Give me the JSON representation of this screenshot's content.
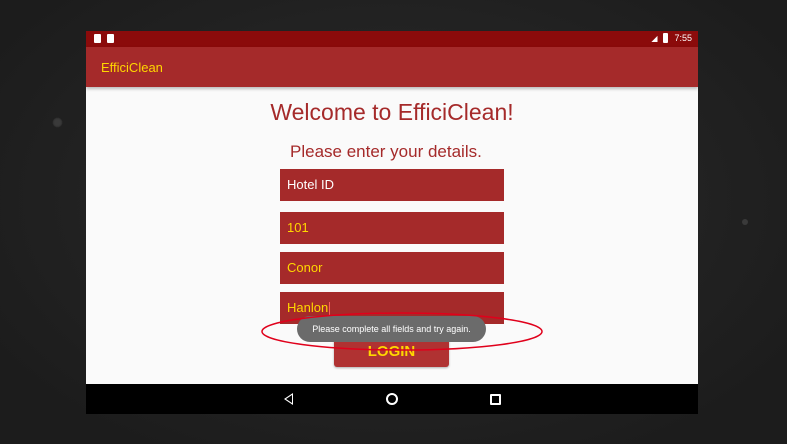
{
  "status_bar": {
    "time": "7:55",
    "left_icons": [
      "notification-icon",
      "android-icon"
    ],
    "right_icons": [
      "signal-icon",
      "battery-icon"
    ]
  },
  "app_bar": {
    "title": "EfficiClean"
  },
  "main": {
    "welcome": "Welcome to EfficiClean!",
    "subtitle": "Please enter your details.",
    "fields": [
      {
        "name": "hotel-id-field",
        "value": "",
        "placeholder": "Hotel ID"
      },
      {
        "name": "room-or-id-field",
        "value": "101",
        "placeholder": ""
      },
      {
        "name": "first-name-field",
        "value": "Conor",
        "placeholder": ""
      },
      {
        "name": "last-name-field",
        "value": "Hanlon",
        "placeholder": ""
      }
    ],
    "login_label": "LOGIN"
  },
  "toast": {
    "message": "Please complete all fields and try again."
  },
  "nav_bar": {
    "icons": [
      "back-icon",
      "home-icon",
      "recents-icon"
    ]
  },
  "colors": {
    "status_bar": "#8b0b0b",
    "primary": "#a52a2a",
    "accent": "#ffd700",
    "annotation": "#e0001b"
  }
}
